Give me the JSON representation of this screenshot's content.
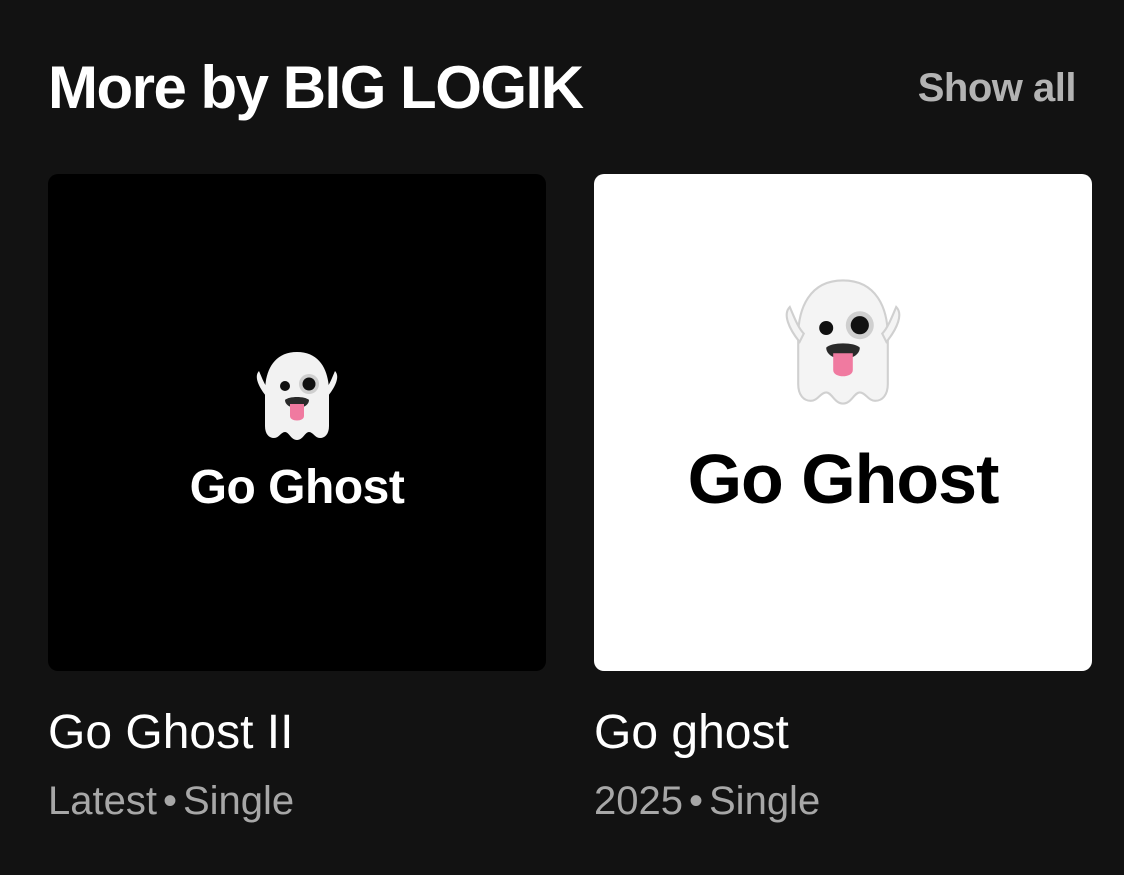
{
  "section": {
    "title": "More by BIG LOGIK",
    "show_all_label": "Show all"
  },
  "releases": [
    {
      "cover_text": "Go Ghost",
      "cover_icon": "ghost-emoji-icon",
      "cover_background": "#000000",
      "title": "Go Ghost II",
      "meta_prefix": "Latest",
      "separator": "•",
      "type": "Single"
    },
    {
      "cover_text": "Go Ghost",
      "cover_icon": "ghost-emoji-icon",
      "cover_background": "#ffffff",
      "title": "Go ghost",
      "meta_prefix": "2025",
      "separator": "•",
      "type": "Single"
    }
  ],
  "colors": {
    "background": "#121212",
    "primary_text": "#ffffff",
    "secondary_text": "#a7a7a7"
  }
}
